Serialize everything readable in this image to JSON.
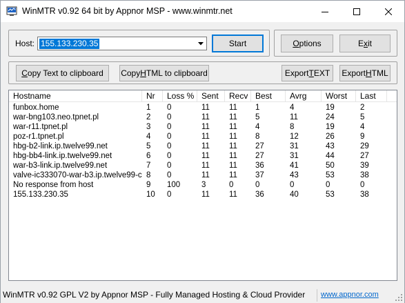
{
  "window": {
    "title": "WinMTR v0.92 64 bit by Appnor MSP - www.winmtr.net"
  },
  "host": {
    "label": "Host:",
    "value": "155.133.230.35"
  },
  "buttons": {
    "start": "Start",
    "options": "Options",
    "exit": "Exit",
    "copy_text": "Copy Text to clipboard",
    "copy_html": "Copy HTML to clipboard",
    "export_text": "Export TEXT",
    "export_html": "Export HTML"
  },
  "table": {
    "columns": [
      "Hostname",
      "Nr",
      "Loss %",
      "Sent",
      "Recv",
      "Best",
      "Avrg",
      "Worst",
      "Last"
    ],
    "rows": [
      [
        "funbox.home",
        "1",
        "0",
        "11",
        "11",
        "1",
        "4",
        "19",
        "2"
      ],
      [
        "war-bng103.neo.tpnet.pl",
        "2",
        "0",
        "11",
        "11",
        "5",
        "11",
        "24",
        "5"
      ],
      [
        "war-r11.tpnet.pl",
        "3",
        "0",
        "11",
        "11",
        "4",
        "8",
        "19",
        "4"
      ],
      [
        "poz-r1.tpnet.pl",
        "4",
        "0",
        "11",
        "11",
        "8",
        "12",
        "26",
        "9"
      ],
      [
        "hbg-b2-link.ip.twelve99.net",
        "5",
        "0",
        "11",
        "11",
        "27",
        "31",
        "43",
        "29"
      ],
      [
        "hbg-bb4-link.ip.twelve99.net",
        "6",
        "0",
        "11",
        "11",
        "27",
        "31",
        "44",
        "27"
      ],
      [
        "war-b3-link.ip.twelve99.net",
        "7",
        "0",
        "11",
        "11",
        "36",
        "41",
        "50",
        "39"
      ],
      [
        "valve-ic333070-war-b3.ip.twelve99-c...",
        "8",
        "0",
        "11",
        "11",
        "37",
        "43",
        "53",
        "38"
      ],
      [
        "No response from host",
        "9",
        "100",
        "3",
        "0",
        "0",
        "0",
        "0",
        "0"
      ],
      [
        "155.133.230.35",
        "10",
        "0",
        "11",
        "11",
        "36",
        "40",
        "53",
        "38"
      ]
    ]
  },
  "statusbar": {
    "text": "WinMTR v0.92 GPL V2 by Appnor MSP - Fully Managed Hosting & Cloud Provider",
    "link": "www.appnor.com"
  }
}
